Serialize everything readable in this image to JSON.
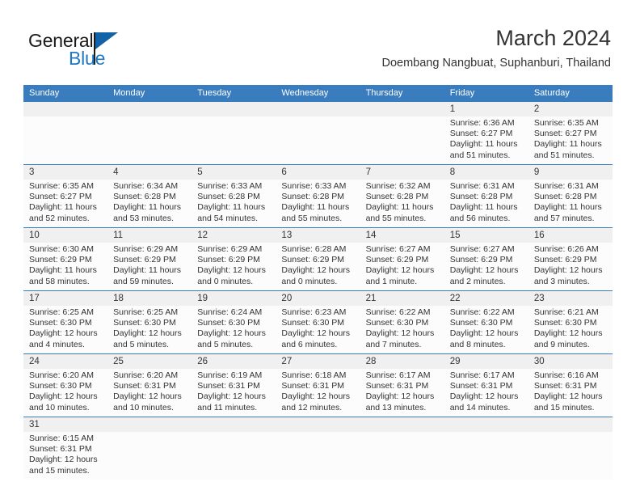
{
  "brand": {
    "name_part1": "General",
    "name_part2": "Blue",
    "triangle_icon": "triangle-logo-icon",
    "accent_color": "#1f78c1",
    "header_color": "#3a7dbf"
  },
  "header": {
    "title": "March 2024",
    "location": "Doembang Nangbuat, Suphanburi, Thailand"
  },
  "calendar": {
    "weekdays": [
      "Sunday",
      "Monday",
      "Tuesday",
      "Wednesday",
      "Thursday",
      "Friday",
      "Saturday"
    ],
    "weeks": [
      [
        {
          "day": "",
          "lines": []
        },
        {
          "day": "",
          "lines": []
        },
        {
          "day": "",
          "lines": []
        },
        {
          "day": "",
          "lines": []
        },
        {
          "day": "",
          "lines": []
        },
        {
          "day": "1",
          "lines": [
            "Sunrise: 6:36 AM",
            "Sunset: 6:27 PM",
            "Daylight: 11 hours",
            "and 51 minutes."
          ]
        },
        {
          "day": "2",
          "lines": [
            "Sunrise: 6:35 AM",
            "Sunset: 6:27 PM",
            "Daylight: 11 hours",
            "and 51 minutes."
          ]
        }
      ],
      [
        {
          "day": "3",
          "lines": [
            "Sunrise: 6:35 AM",
            "Sunset: 6:27 PM",
            "Daylight: 11 hours",
            "and 52 minutes."
          ]
        },
        {
          "day": "4",
          "lines": [
            "Sunrise: 6:34 AM",
            "Sunset: 6:28 PM",
            "Daylight: 11 hours",
            "and 53 minutes."
          ]
        },
        {
          "day": "5",
          "lines": [
            "Sunrise: 6:33 AM",
            "Sunset: 6:28 PM",
            "Daylight: 11 hours",
            "and 54 minutes."
          ]
        },
        {
          "day": "6",
          "lines": [
            "Sunrise: 6:33 AM",
            "Sunset: 6:28 PM",
            "Daylight: 11 hours",
            "and 55 minutes."
          ]
        },
        {
          "day": "7",
          "lines": [
            "Sunrise: 6:32 AM",
            "Sunset: 6:28 PM",
            "Daylight: 11 hours",
            "and 55 minutes."
          ]
        },
        {
          "day": "8",
          "lines": [
            "Sunrise: 6:31 AM",
            "Sunset: 6:28 PM",
            "Daylight: 11 hours",
            "and 56 minutes."
          ]
        },
        {
          "day": "9",
          "lines": [
            "Sunrise: 6:31 AM",
            "Sunset: 6:28 PM",
            "Daylight: 11 hours",
            "and 57 minutes."
          ]
        }
      ],
      [
        {
          "day": "10",
          "lines": [
            "Sunrise: 6:30 AM",
            "Sunset: 6:29 PM",
            "Daylight: 11 hours",
            "and 58 minutes."
          ]
        },
        {
          "day": "11",
          "lines": [
            "Sunrise: 6:29 AM",
            "Sunset: 6:29 PM",
            "Daylight: 11 hours",
            "and 59 minutes."
          ]
        },
        {
          "day": "12",
          "lines": [
            "Sunrise: 6:29 AM",
            "Sunset: 6:29 PM",
            "Daylight: 12 hours",
            "and 0 minutes."
          ]
        },
        {
          "day": "13",
          "lines": [
            "Sunrise: 6:28 AM",
            "Sunset: 6:29 PM",
            "Daylight: 12 hours",
            "and 0 minutes."
          ]
        },
        {
          "day": "14",
          "lines": [
            "Sunrise: 6:27 AM",
            "Sunset: 6:29 PM",
            "Daylight: 12 hours",
            "and 1 minute."
          ]
        },
        {
          "day": "15",
          "lines": [
            "Sunrise: 6:27 AM",
            "Sunset: 6:29 PM",
            "Daylight: 12 hours",
            "and 2 minutes."
          ]
        },
        {
          "day": "16",
          "lines": [
            "Sunrise: 6:26 AM",
            "Sunset: 6:29 PM",
            "Daylight: 12 hours",
            "and 3 minutes."
          ]
        }
      ],
      [
        {
          "day": "17",
          "lines": [
            "Sunrise: 6:25 AM",
            "Sunset: 6:30 PM",
            "Daylight: 12 hours",
            "and 4 minutes."
          ]
        },
        {
          "day": "18",
          "lines": [
            "Sunrise: 6:25 AM",
            "Sunset: 6:30 PM",
            "Daylight: 12 hours",
            "and 5 minutes."
          ]
        },
        {
          "day": "19",
          "lines": [
            "Sunrise: 6:24 AM",
            "Sunset: 6:30 PM",
            "Daylight: 12 hours",
            "and 5 minutes."
          ]
        },
        {
          "day": "20",
          "lines": [
            "Sunrise: 6:23 AM",
            "Sunset: 6:30 PM",
            "Daylight: 12 hours",
            "and 6 minutes."
          ]
        },
        {
          "day": "21",
          "lines": [
            "Sunrise: 6:22 AM",
            "Sunset: 6:30 PM",
            "Daylight: 12 hours",
            "and 7 minutes."
          ]
        },
        {
          "day": "22",
          "lines": [
            "Sunrise: 6:22 AM",
            "Sunset: 6:30 PM",
            "Daylight: 12 hours",
            "and 8 minutes."
          ]
        },
        {
          "day": "23",
          "lines": [
            "Sunrise: 6:21 AM",
            "Sunset: 6:30 PM",
            "Daylight: 12 hours",
            "and 9 minutes."
          ]
        }
      ],
      [
        {
          "day": "24",
          "lines": [
            "Sunrise: 6:20 AM",
            "Sunset: 6:30 PM",
            "Daylight: 12 hours",
            "and 10 minutes."
          ]
        },
        {
          "day": "25",
          "lines": [
            "Sunrise: 6:20 AM",
            "Sunset: 6:31 PM",
            "Daylight: 12 hours",
            "and 10 minutes."
          ]
        },
        {
          "day": "26",
          "lines": [
            "Sunrise: 6:19 AM",
            "Sunset: 6:31 PM",
            "Daylight: 12 hours",
            "and 11 minutes."
          ]
        },
        {
          "day": "27",
          "lines": [
            "Sunrise: 6:18 AM",
            "Sunset: 6:31 PM",
            "Daylight: 12 hours",
            "and 12 minutes."
          ]
        },
        {
          "day": "28",
          "lines": [
            "Sunrise: 6:17 AM",
            "Sunset: 6:31 PM",
            "Daylight: 12 hours",
            "and 13 minutes."
          ]
        },
        {
          "day": "29",
          "lines": [
            "Sunrise: 6:17 AM",
            "Sunset: 6:31 PM",
            "Daylight: 12 hours",
            "and 14 minutes."
          ]
        },
        {
          "day": "30",
          "lines": [
            "Sunrise: 6:16 AM",
            "Sunset: 6:31 PM",
            "Daylight: 12 hours",
            "and 15 minutes."
          ]
        }
      ],
      [
        {
          "day": "31",
          "lines": [
            "Sunrise: 6:15 AM",
            "Sunset: 6:31 PM",
            "Daylight: 12 hours",
            "and 15 minutes."
          ]
        },
        {
          "day": "",
          "lines": []
        },
        {
          "day": "",
          "lines": []
        },
        {
          "day": "",
          "lines": []
        },
        {
          "day": "",
          "lines": []
        },
        {
          "day": "",
          "lines": []
        },
        {
          "day": "",
          "lines": []
        }
      ]
    ]
  }
}
